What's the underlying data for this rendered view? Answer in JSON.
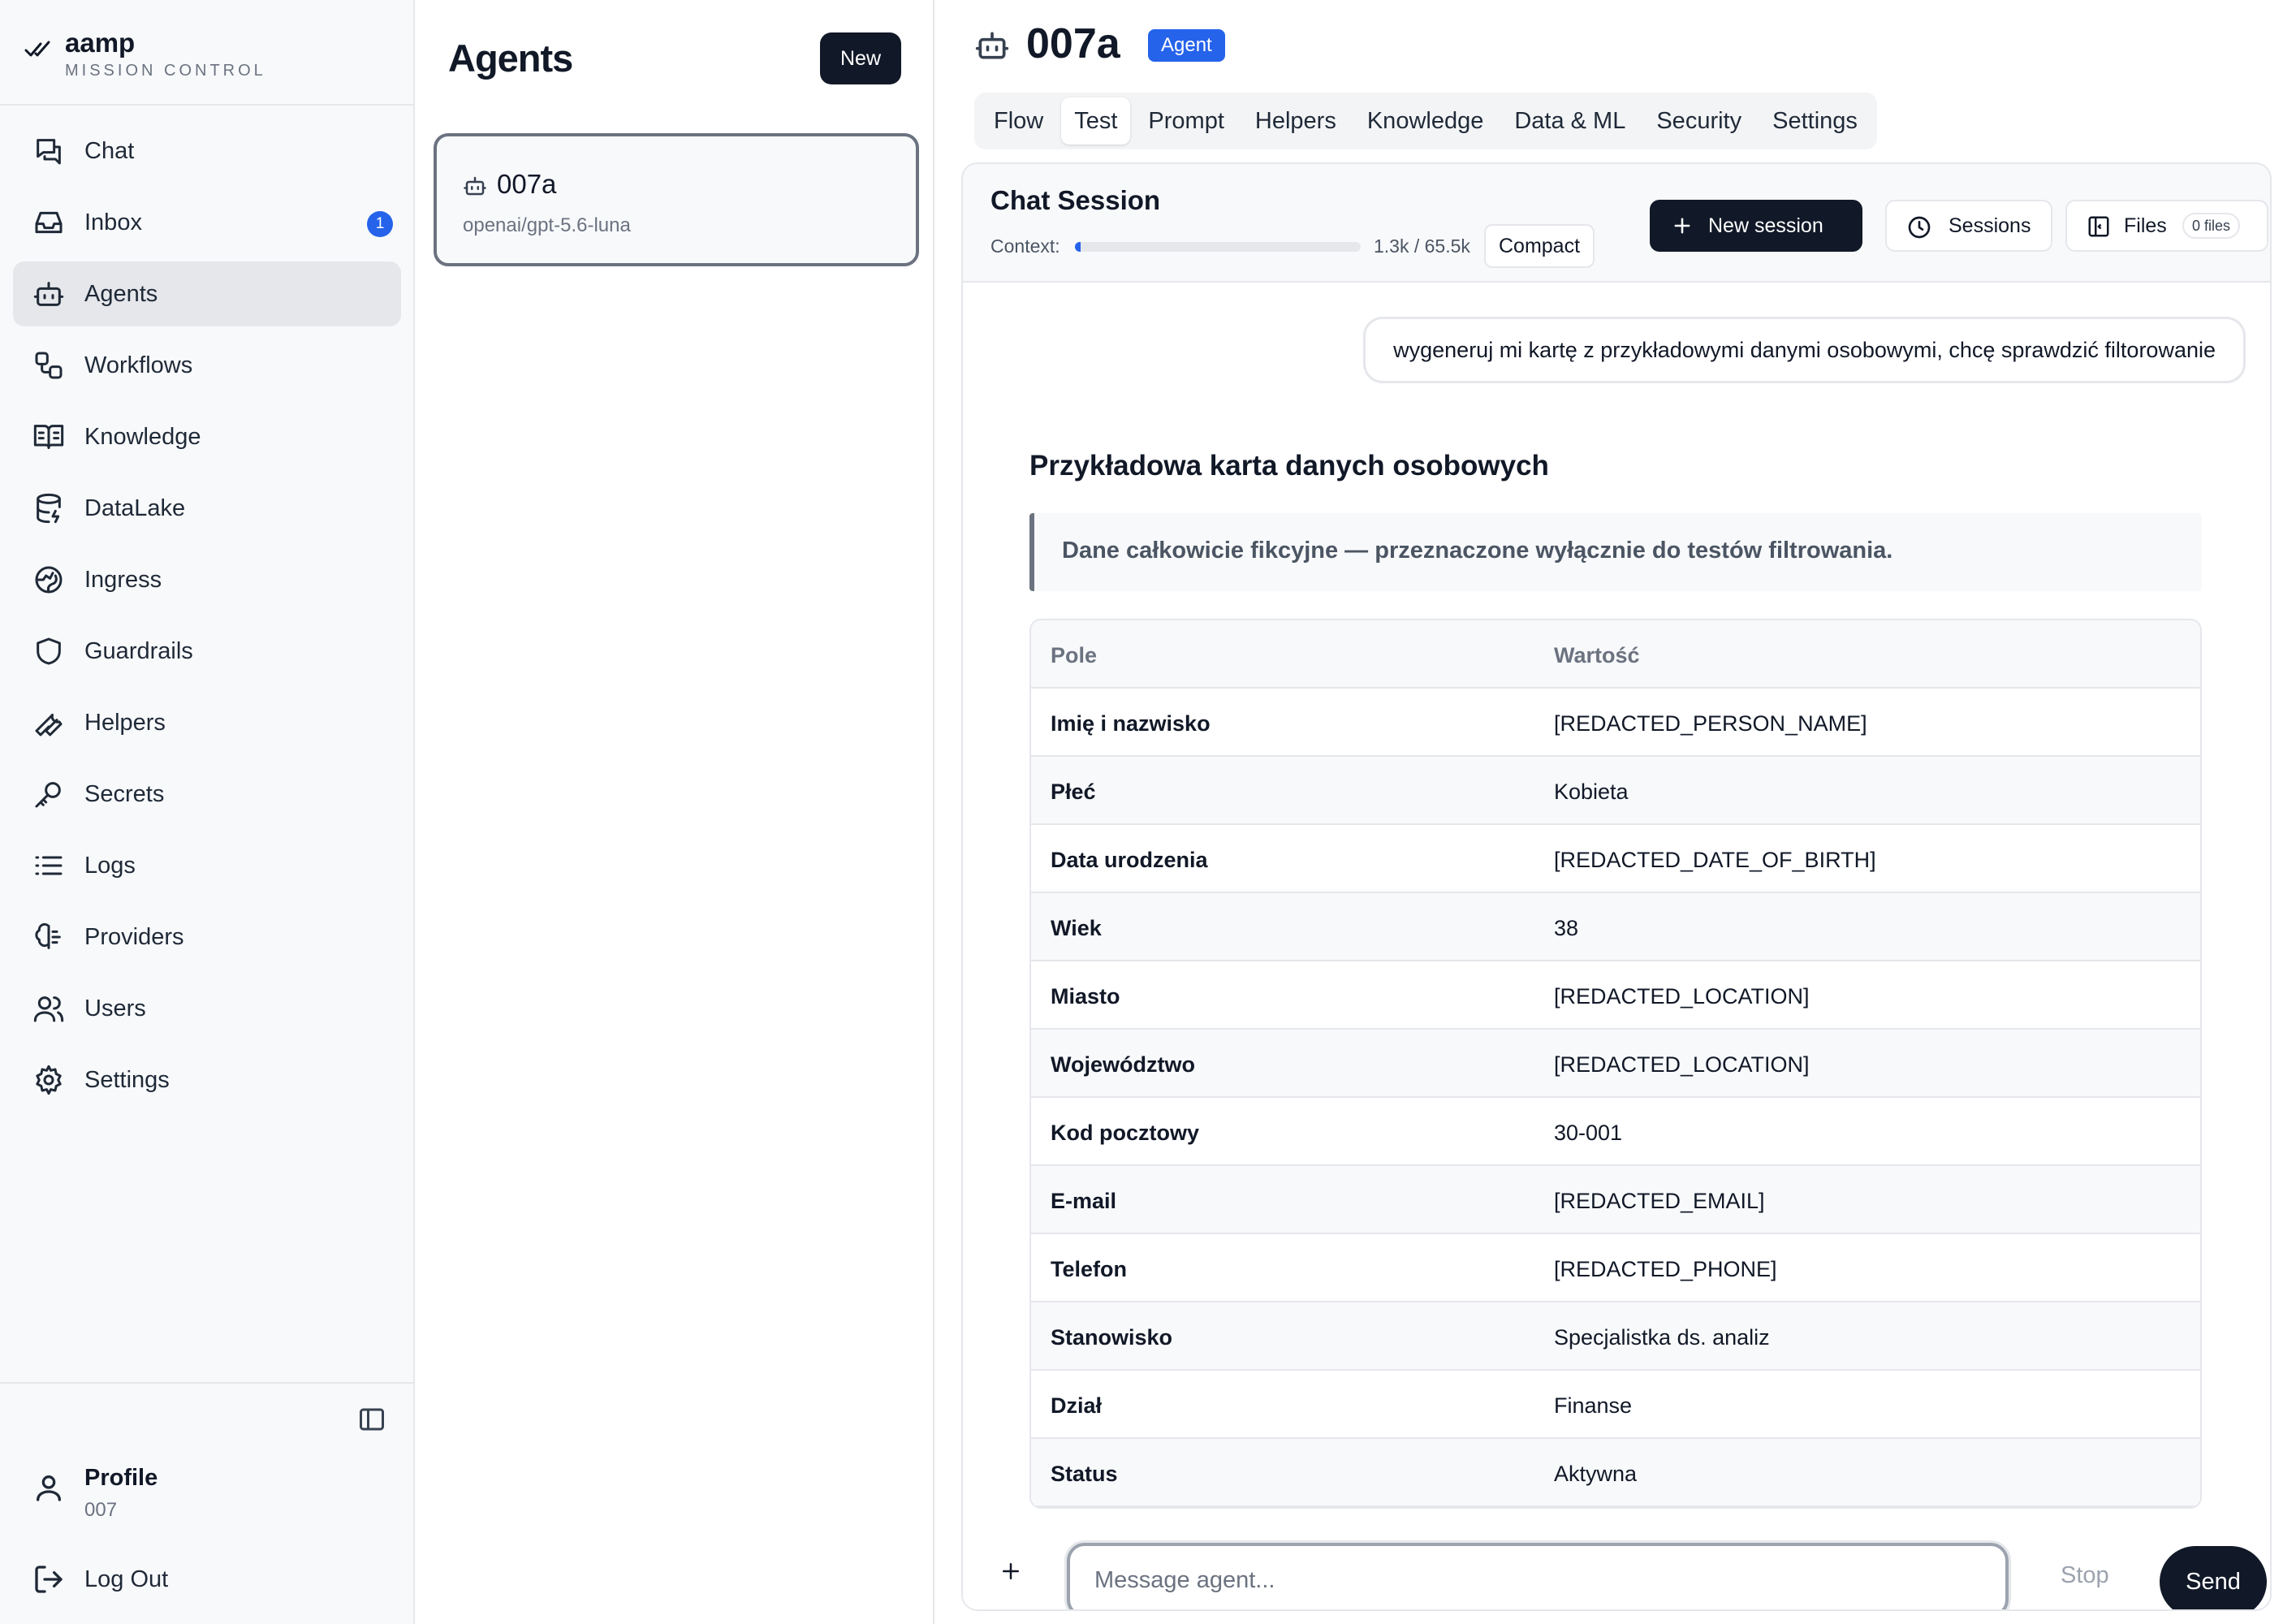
{
  "brand": {
    "name": "aamp",
    "subtitle": "MISSION CONTROL"
  },
  "sidebar": {
    "items": [
      {
        "label": "Chat",
        "icon": "chat-icon"
      },
      {
        "label": "Inbox",
        "icon": "inbox-icon",
        "badge": "1"
      },
      {
        "label": "Agents",
        "icon": "bot-icon",
        "active": true
      },
      {
        "label": "Workflows",
        "icon": "workflow-icon"
      },
      {
        "label": "Knowledge",
        "icon": "book-icon"
      },
      {
        "label": "DataLake",
        "icon": "database-icon"
      },
      {
        "label": "Ingress",
        "icon": "globe-icon"
      },
      {
        "label": "Guardrails",
        "icon": "shield-icon"
      },
      {
        "label": "Helpers",
        "icon": "wrench-icon"
      },
      {
        "label": "Secrets",
        "icon": "key-icon"
      },
      {
        "label": "Logs",
        "icon": "list-icon"
      },
      {
        "label": "Providers",
        "icon": "brain-icon"
      },
      {
        "label": "Users",
        "icon": "users-icon"
      },
      {
        "label": "Settings",
        "icon": "gear-icon"
      }
    ],
    "profile": {
      "name": "Profile",
      "id": "007"
    },
    "logout_label": "Log Out"
  },
  "agents": {
    "title": "Agents",
    "new_label": "New",
    "list": [
      {
        "name": "007a",
        "model": "openai/gpt-5.6-luna"
      }
    ]
  },
  "main": {
    "title": "007a",
    "badge": "Agent",
    "tabs": [
      "Flow",
      "Test",
      "Prompt",
      "Helpers",
      "Knowledge",
      "Data & ML",
      "Security",
      "Settings"
    ],
    "active_tab": "Test",
    "session": {
      "title": "Chat Session",
      "context_label": "Context:",
      "context_value": "1.3k / 65.5k",
      "context_fraction": 0.02,
      "compact_label": "Compact",
      "new_session_label": "New session",
      "sessions_label": "Sessions",
      "files_label": "Files",
      "files_count": "0 files"
    },
    "messages": {
      "user": "wygeneruj mi kartę z przykładowymi danymi osobowymi, chcę sprawdzić filtorowanie",
      "response_title": "Przykładowa karta danych osobowych",
      "note": "Dane całkowicie fikcyjne — przeznaczone wyłącznie do testów filtrowania.",
      "table": {
        "headers": [
          "Pole",
          "Wartość"
        ],
        "rows": [
          [
            "Imię i nazwisko",
            "[REDACTED_PERSON_NAME]"
          ],
          [
            "Płeć",
            "Kobieta"
          ],
          [
            "Data urodzenia",
            "[REDACTED_DATE_OF_BIRTH]"
          ],
          [
            "Wiek",
            "38"
          ],
          [
            "Miasto",
            "[REDACTED_LOCATION]"
          ],
          [
            "Województwo",
            "[REDACTED_LOCATION]"
          ],
          [
            "Kod pocztowy",
            "30-001"
          ],
          [
            "E-mail",
            "[REDACTED_EMAIL]"
          ],
          [
            "Telefon",
            "[REDACTED_PHONE]"
          ],
          [
            "Stanowisko",
            "Specjalistka ds. analiz"
          ],
          [
            "Dział",
            "Finanse"
          ],
          [
            "Status",
            "Aktywna"
          ]
        ]
      }
    },
    "composer": {
      "placeholder": "Message agent...",
      "stop_label": "Stop",
      "send_label": "Send"
    }
  }
}
